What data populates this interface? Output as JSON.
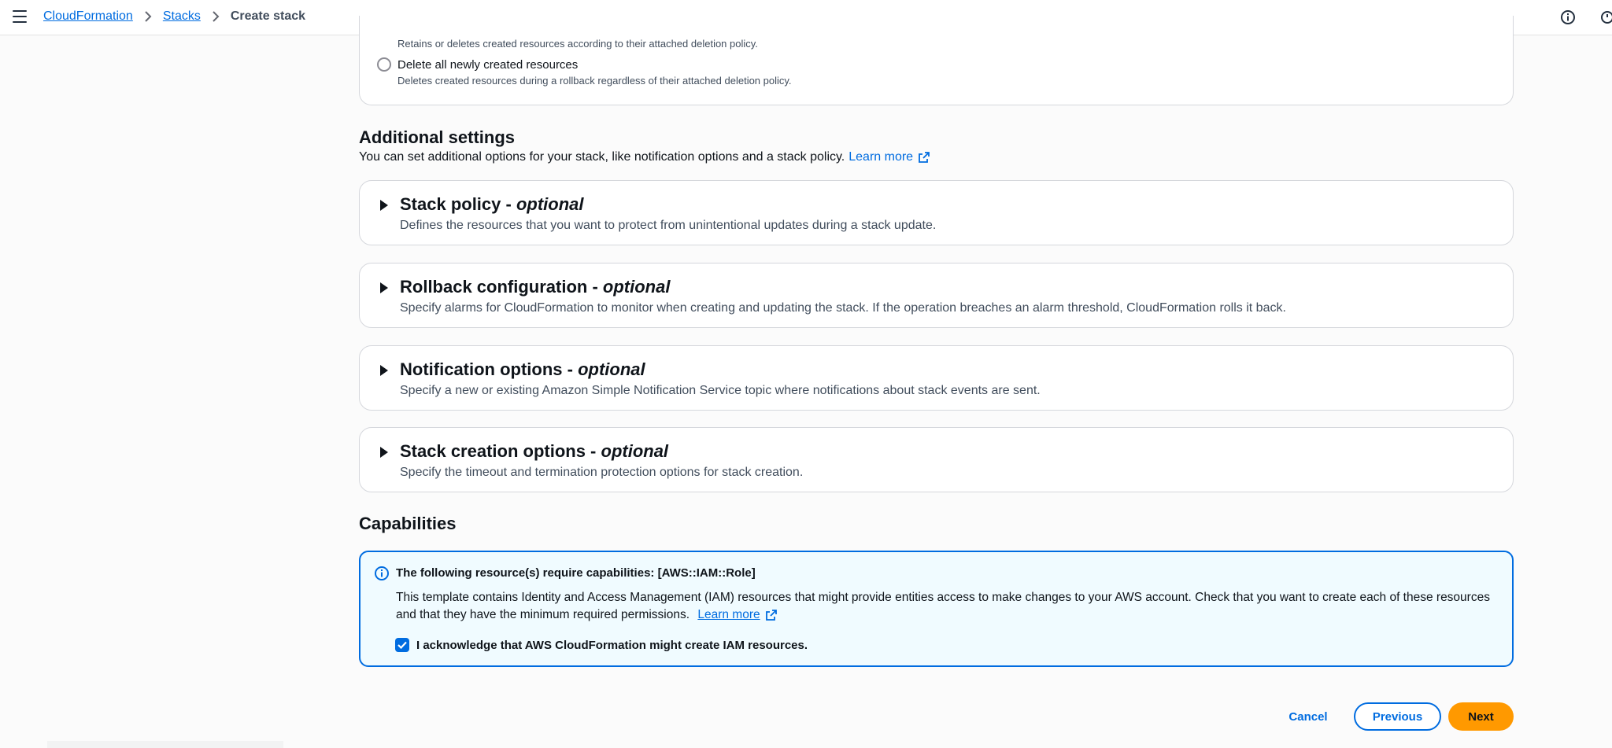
{
  "breadcrumb": {
    "items": [
      "CloudFormation",
      "Stacks"
    ],
    "current": "Create stack"
  },
  "deletion": {
    "retain_desc": "Retains or deletes created resources according to their attached deletion policy.",
    "delete_all_label": "Delete all newly created resources",
    "delete_all_desc": "Deletes created resources during a rollback regardless of their attached deletion policy."
  },
  "additional": {
    "title": "Additional settings",
    "desc": "You can set additional options for your stack, like notification options and a stack policy.",
    "learn_more": "Learn more",
    "cards": [
      {
        "title": "Stack policy - ",
        "optional": "optional",
        "desc": "Defines the resources that you want to protect from unintentional updates during a stack update."
      },
      {
        "title": "Rollback configuration - ",
        "optional": "optional",
        "desc": "Specify alarms for CloudFormation to monitor when creating and updating the stack. If the operation breaches an alarm threshold, CloudFormation rolls it back."
      },
      {
        "title": "Notification options - ",
        "optional": "optional",
        "desc": "Specify a new or existing Amazon Simple Notification Service topic where notifications about stack events are sent."
      },
      {
        "title": "Stack creation options - ",
        "optional": "optional",
        "desc": "Specify the timeout and termination protection options for stack creation."
      }
    ]
  },
  "capabilities": {
    "title": "Capabilities",
    "alert_header": "The following resource(s) require capabilities: [AWS::IAM::Role]",
    "alert_body": "This template contains Identity and Access Management (IAM) resources that might provide entities access to make changes to your AWS account. Check that you want to create each of these resources and that they have the minimum required permissions.",
    "learn_more": "Learn more",
    "ack_label": "I acknowledge that AWS CloudFormation might create IAM resources.",
    "ack_checked": true
  },
  "footer": {
    "cancel": "Cancel",
    "previous": "Previous",
    "next": "Next"
  },
  "colors": {
    "link": "#006ce0",
    "primary_button": "#ff9900",
    "alert_bg": "#f0fbff"
  }
}
